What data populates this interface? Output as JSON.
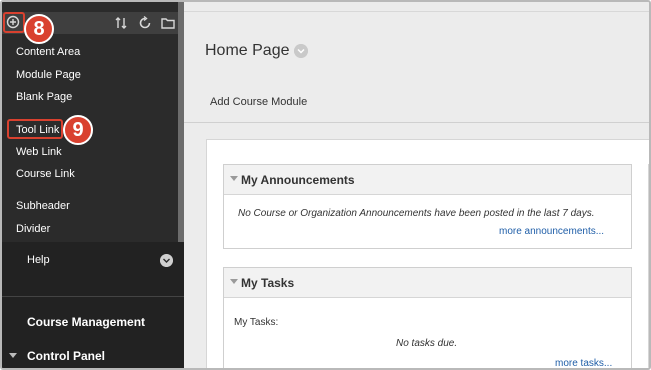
{
  "sidebar": {
    "toolbar": {
      "add_icon": "plus-circle-icon",
      "sort_icon": "sort-arrows-icon",
      "refresh_icon": "refresh-icon",
      "folder_icon": "folder-icon"
    },
    "badge_8": "8",
    "badge_9": "9",
    "menu": [
      "Content Area",
      "Module Page",
      "Blank Page",
      "Tool Link",
      "Web Link",
      "Course Link",
      "Subheader",
      "Divider"
    ],
    "help_label": "Help",
    "course_management": "Course Management",
    "control_panel": "Control Panel"
  },
  "main": {
    "page_title": "Home Page",
    "add_course_module": "Add Course Module",
    "announcements": {
      "title": "My Announcements",
      "message": "No Course or Organization Announcements have been posted in the last 7 days.",
      "more_link": "more announcements..."
    },
    "tasks": {
      "title": "My Tasks",
      "label": "My Tasks:",
      "message": "No tasks due.",
      "more_link": "more tasks..."
    }
  },
  "colors": {
    "highlight": "#d9412f",
    "sidebar_bg": "#2b2b2b",
    "link": "#1f5ea8"
  }
}
